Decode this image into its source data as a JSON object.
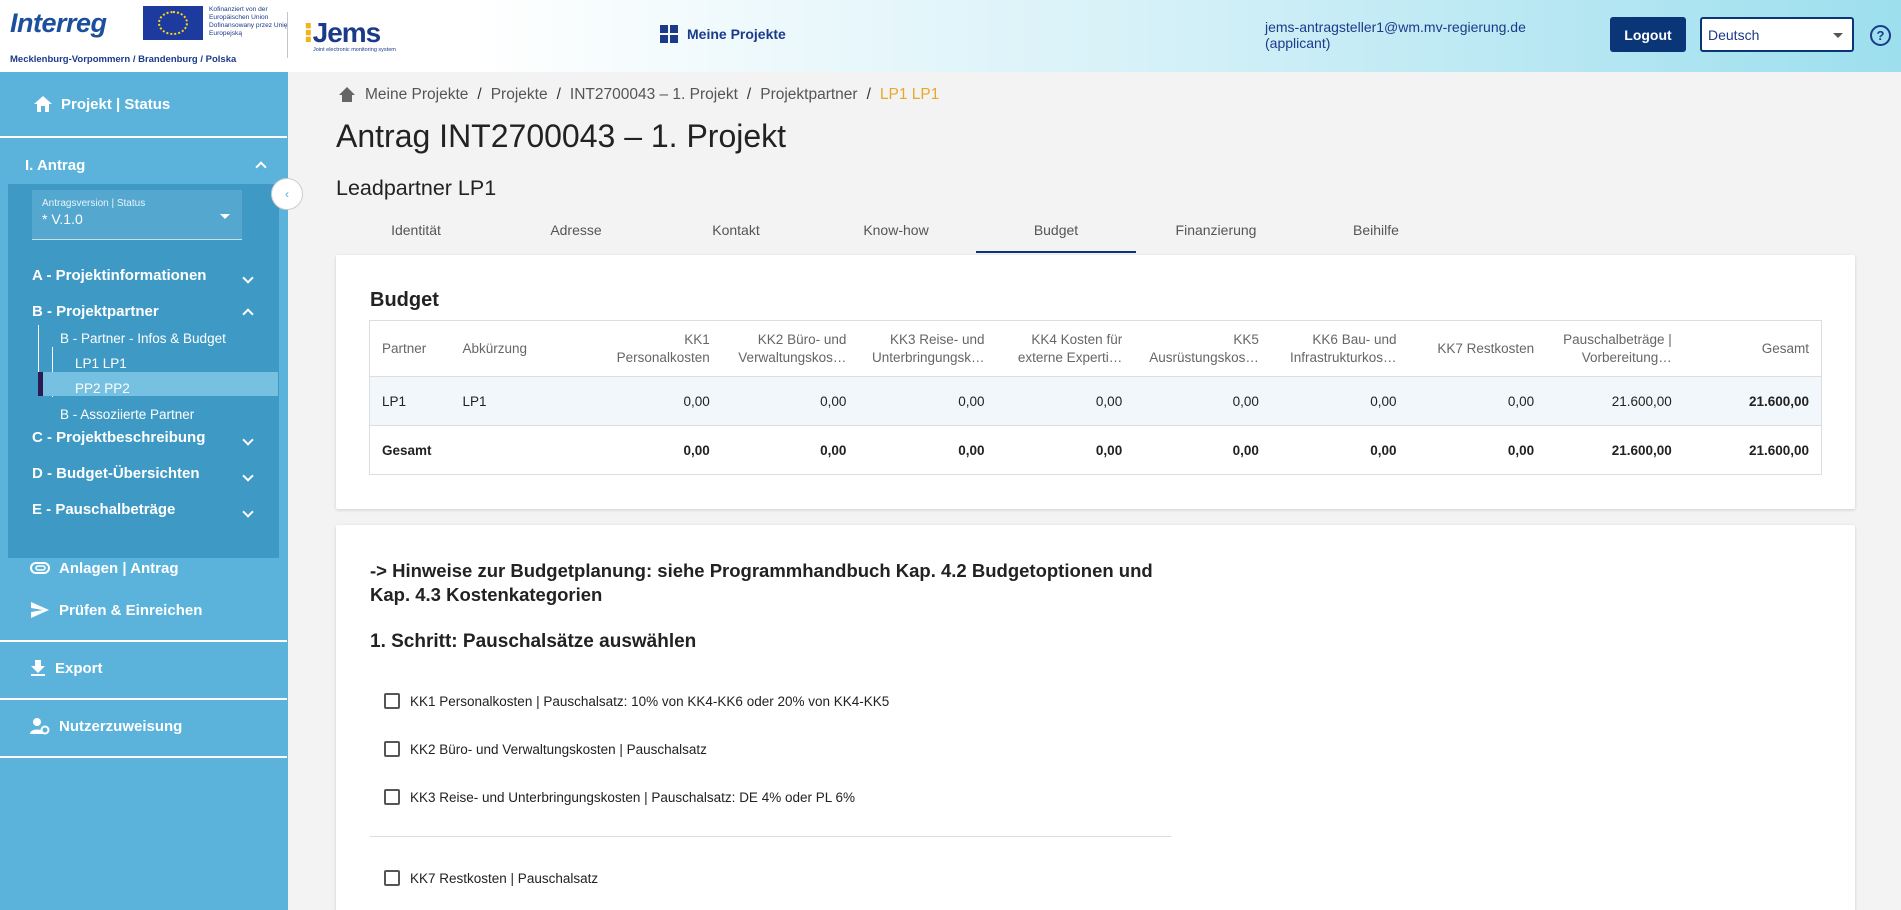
{
  "header": {
    "brand_name": "Interreg",
    "eu_text": "Kofinanziert von der Europäischen Union Dofinansowany przez Unię Europejską",
    "region": "Mecklenburg-Vorpommern / Brandenburg / Polska",
    "jems_name": "Jems",
    "jems_sub": "Joint electronic monitoring system",
    "nav_projects": "Meine Projekte",
    "user_email": "jems-antragsteller1@wm.mv-regierung.de",
    "user_role": "(applicant)",
    "logout": "Logout",
    "language": "Deutsch",
    "help": "?"
  },
  "sidebar": {
    "status": "Projekt | Status",
    "antrag": "I. Antrag",
    "version_label": "Antragsversion | Status",
    "version_value": "* V.1.0",
    "sections": {
      "a": "A - Projektinformationen",
      "b": "B - Projektpartner",
      "b_partner_info": "B - Partner - Infos & Budget",
      "lp1": "LP1 LP1",
      "pp2": "PP2 PP2",
      "b_assoc": "B - Assoziierte Partner",
      "c": "C - Projektbeschreibung",
      "d": "D - Budget-Übersichten",
      "e": "E - Pauschalbeträge"
    },
    "anlagen": "Anlagen | Antrag",
    "pruefen": "Prüfen & Einreichen",
    "export": "Export",
    "nutzer": "Nutzerzuweisung"
  },
  "breadcrumb": [
    "Meine Projekte",
    "Projekte",
    "INT2700043 – 1. Projekt",
    "Projektpartner",
    "LP1 LP1"
  ],
  "page_title": "Antrag INT2700043 – 1. Projekt",
  "sub_title": "Leadpartner LP1",
  "tabs": [
    "Identität",
    "Adresse",
    "Kontakt",
    "Know-how",
    "Budget",
    "Finanzierung",
    "Beihilfe"
  ],
  "budget": {
    "title": "Budget",
    "headers": [
      "Partner",
      "Abkürzung",
      "KK1 Personalkosten",
      "KK2 Büro- und Verwaltungskos…",
      "KK3 Reise- und Unterbringungsk…",
      "KK4 Kosten für externe Experti…",
      "KK5 Ausrüstungskos…",
      "KK6 Bau- und Infrastrukturkos…",
      "KK7 Restkosten",
      "Pauschalbeträge | Vorbereitung…",
      "Gesamt"
    ],
    "rows": [
      [
        "LP1",
        "LP1",
        "0,00",
        "0,00",
        "0,00",
        "0,00",
        "0,00",
        "0,00",
        "0,00",
        "21.600,00",
        "21.600,00"
      ],
      [
        "Gesamt",
        "",
        "0,00",
        "0,00",
        "0,00",
        "0,00",
        "0,00",
        "0,00",
        "0,00",
        "21.600,00",
        "21.600,00"
      ]
    ]
  },
  "hints": {
    "hint": "-> Hinweise zur Budgetplanung: siehe Programmhandbuch Kap. 4.2 Budgetoptionen und Kap. 4.3 Kostenkategorien",
    "step1": "1. Schritt: Pauschalsätze auswählen",
    "checkboxes": [
      "KK1 Personalkosten | Pauschalsatz: 10% von KK4-KK6 oder 20% von KK4-KK5",
      "KK2 Büro- und Verwaltungskosten | Pauschalsatz",
      "KK3 Reise- und Unterbringungskosten | Pauschalsatz: DE 4% oder PL 6%",
      "KK7 Restkosten | Pauschalsatz"
    ]
  }
}
